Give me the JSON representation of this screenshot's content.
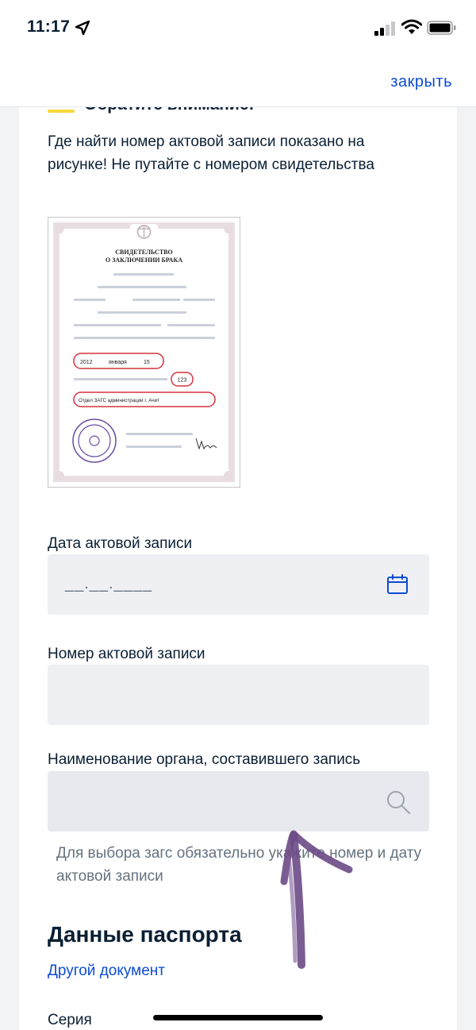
{
  "status_bar": {
    "time": "11:17",
    "icons": [
      "location-arrow-icon",
      "signal-icon",
      "wifi-icon",
      "battery-icon"
    ]
  },
  "top_bar": {
    "close_label": "закрыть"
  },
  "notice": {
    "title": "Обратите внимание!",
    "text": "Где найти номер актовой записи показано на рисунке! Не путайте с номером свидетельства"
  },
  "certificate_image": {
    "title_line1": "СВИДЕТЕЛЬСТВО",
    "title_line2": "О ЗАКЛЮЧЕНИИ БРАКА",
    "date_year": "2012",
    "date_month": "января",
    "date_day": "15",
    "record_number": "123",
    "authority": "Отдел ЗАГС администрации г. Ачит"
  },
  "form": {
    "record_date": {
      "label": "Дата актовой записи",
      "placeholder": "__.__.____"
    },
    "record_number": {
      "label": "Номер актовой записи",
      "value": ""
    },
    "authority": {
      "label": "Наименование органа, составившего запись",
      "value": ""
    },
    "hint": "Для выбора загс обязательно укажите номер и дату актовой записи"
  },
  "passport": {
    "title": "Данные паспорта",
    "other_doc_link": "Другой документ",
    "series_label": "Серия"
  },
  "colors": {
    "accent": "#0d4cd3",
    "notice_bar": "#f5d73a",
    "field_bg": "#eef0f4",
    "hint_text": "#66727f",
    "annotation_arrow": "#6b4a86"
  }
}
